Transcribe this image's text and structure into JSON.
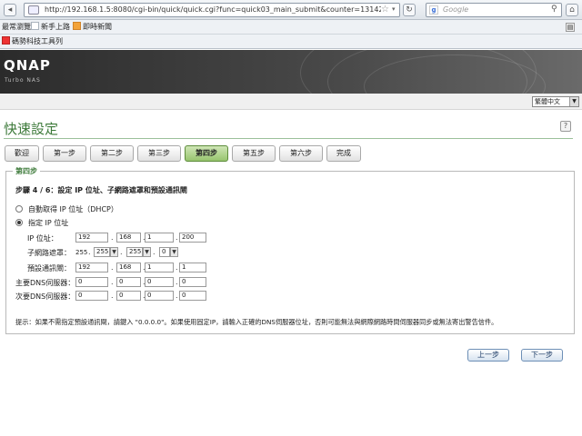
{
  "browser": {
    "url": "http://192.168.1.5:8080/cgi-bin/quick/quick.cgi?func=quick03_main_submit&counter=1314236445&subf",
    "search_placeholder": "Google",
    "bookmarks_row1": [
      "最常瀏覽",
      "新手上路",
      "即時新聞"
    ],
    "bookmarks_row2": [
      "碼勢科技工具列"
    ]
  },
  "header": {
    "logo": "QNAP",
    "subtitle": "Turbo NAS",
    "language": "繁體中文"
  },
  "page": {
    "title": "快速設定",
    "help_icon": "help-icon"
  },
  "steps": [
    {
      "label": "歡迎",
      "active": false
    },
    {
      "label": "第一步",
      "active": false
    },
    {
      "label": "第二步",
      "active": false
    },
    {
      "label": "第三步",
      "active": false
    },
    {
      "label": "第四步",
      "active": true
    },
    {
      "label": "第五步",
      "active": false
    },
    {
      "label": "第六步",
      "active": false
    },
    {
      "label": "完成",
      "active": false
    }
  ],
  "form": {
    "legend": "第四步",
    "heading": "步驟 4 / 6：設定 IP 位址、子網路遮罩和預設通訊閘",
    "option_dhcp": "自動取得 IP 位址（DHCP）",
    "option_static": "指定 IP 位址",
    "selected": "static",
    "ip_label": "IP 位址：",
    "ip": [
      "192",
      "168",
      "1",
      "200"
    ],
    "mask_label": "子網路遮罩：",
    "mask": [
      "255",
      "255",
      "255",
      "0"
    ],
    "gateway_label": "預設通訊閘：",
    "gateway": [
      "192",
      "168",
      "1",
      "1"
    ],
    "dns1_label": "主要DNS伺服器：",
    "dns1": [
      "0",
      "0",
      "0",
      "0"
    ],
    "dns2_label": "次要DNS伺服器：",
    "dns2": [
      "0",
      "0",
      "0",
      "0"
    ],
    "hint": "提示：如果不需指定預設通訊閘，請鍵入 \"0.0.0.0\"。如果使用固定IP，請輸入正確的DNS伺服器位址，否則可能無法與網際網路時間伺服器同步或無法寄出警告信件。"
  },
  "buttons": {
    "prev": "上一步",
    "next": "下一步"
  }
}
